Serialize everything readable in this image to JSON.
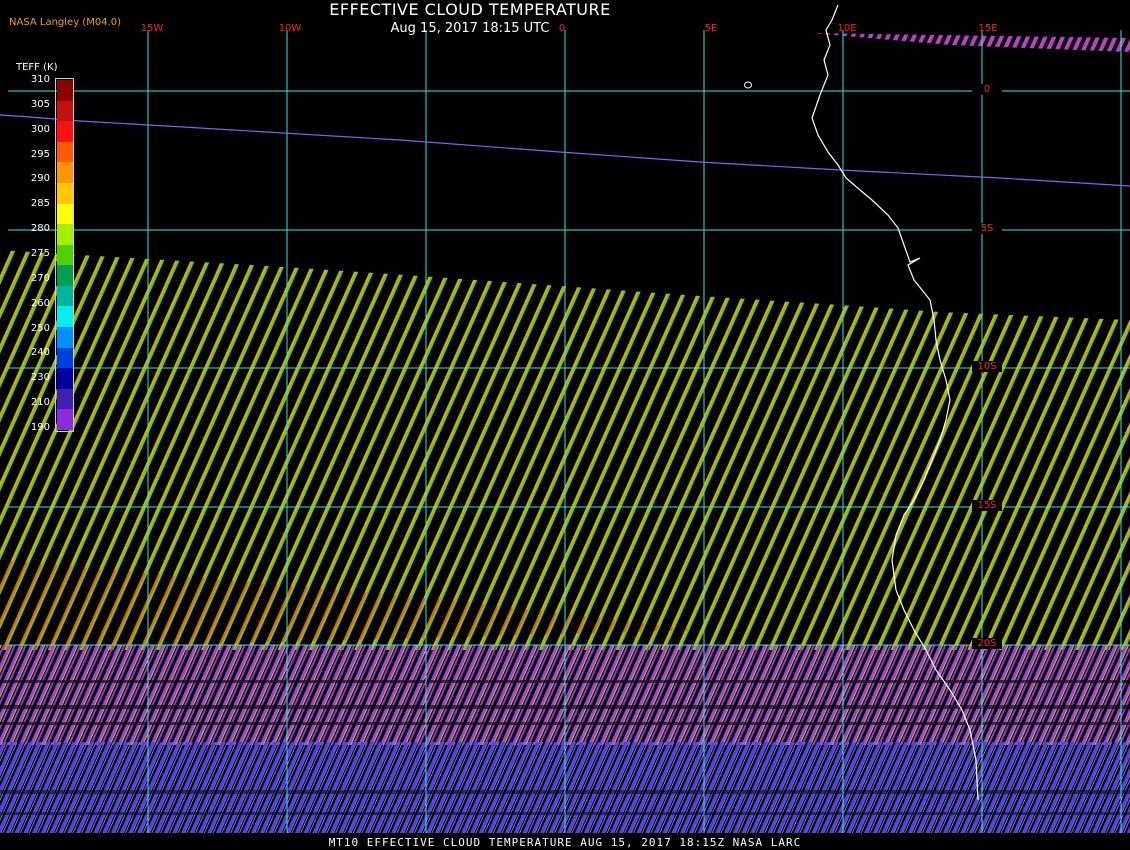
{
  "header": {
    "title": "EFFECTIVE CLOUD TEMPERATURE",
    "subtitle": "Aug 15, 2017 18:15 UTC",
    "source": "NASA Langley (M04.0)"
  },
  "legend": {
    "title": "TEFF (K)",
    "ticks": [
      "310",
      "305",
      "300",
      "295",
      "290",
      "285",
      "280",
      "275",
      "270",
      "260",
      "250",
      "240",
      "230",
      "210",
      "190"
    ],
    "colors": [
      "#8b0000",
      "#c01010",
      "#ff1010",
      "#ff5a00",
      "#ff9600",
      "#ffc800",
      "#ffff00",
      "#a0f000",
      "#50d000",
      "#00a050",
      "#00b4a0",
      "#00f0f0",
      "#0090ff",
      "#0040e0",
      "#0000a0",
      "#4020b0",
      "#8a2be2"
    ]
  },
  "grid": {
    "lon_labels": [
      "15W",
      "10W",
      "0",
      "5E",
      "10E",
      "15E"
    ],
    "lat_labels": [
      "0",
      "5S",
      "10S",
      "15S",
      "20S"
    ],
    "color": "#40e0e0",
    "label_color": "#ff2020"
  },
  "footer": {
    "text": "MT10  EFFECTIVE CLOUD TEMPERATURE  AUG 15, 2017 18:15Z  NASA LARC"
  },
  "colors": {
    "coastline": "#ffffff",
    "terminator": "#8060ff",
    "swath_warm": "#c8c000",
    "swath_green": "#80c020",
    "swath_red": "#d04020",
    "swath_cold": "#a040e0",
    "swath_blue": "#4040e0"
  }
}
